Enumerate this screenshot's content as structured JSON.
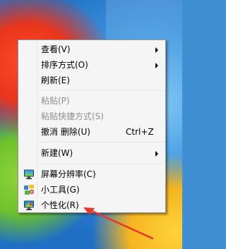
{
  "menu": {
    "items": [
      {
        "label": "查看(V)",
        "submenu": true
      },
      {
        "label": "排序方式(O)",
        "submenu": true
      },
      {
        "label": "刷新(E)"
      },
      {
        "label": "粘贴(P)",
        "disabled": true
      },
      {
        "label": "粘贴快捷方式(S)",
        "disabled": true
      },
      {
        "label": "撤消 删除(U)",
        "shortcut": "Ctrl+Z"
      },
      {
        "label": "新建(W)",
        "submenu": true
      },
      {
        "label": "屏幕分辨率(C)",
        "icon": "monitor-icon"
      },
      {
        "label": "小工具(G)",
        "icon": "gadgets-icon"
      },
      {
        "label": "个性化(R)",
        "icon": "personalize-icon"
      }
    ]
  },
  "annotation": {
    "color": "#e8372a"
  }
}
